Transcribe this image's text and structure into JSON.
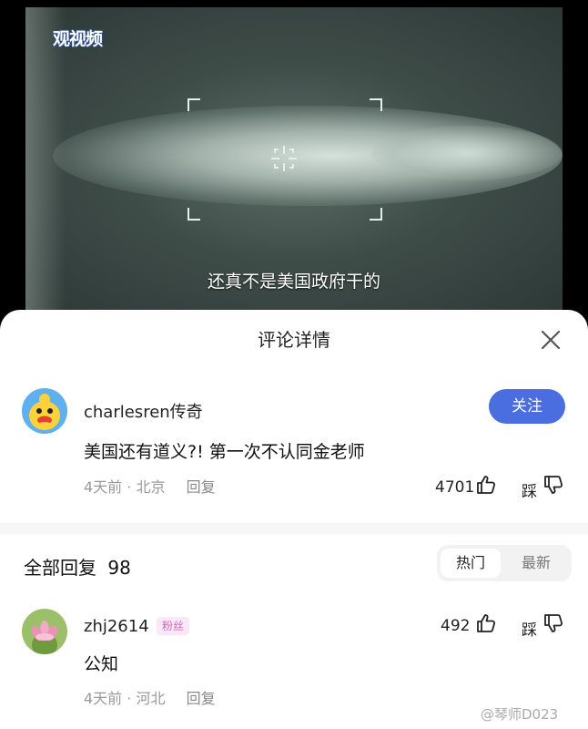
{
  "video": {
    "logo_text": "观视频",
    "subtitle": "还真不是美国政府干的"
  },
  "sheet": {
    "title": "评论详情"
  },
  "main_comment": {
    "username": "charlesren传奇",
    "follow_label": "关注",
    "text": "美国还有道义?! 第一次不认同金老师",
    "time": "4天前",
    "location": "北京",
    "reply_label": "回复",
    "likes": "4701",
    "dislike_label": "踩"
  },
  "replies_section": {
    "title": "全部回复",
    "count": "98",
    "sort_options": [
      "热门",
      "最新"
    ],
    "active_sort": "热门"
  },
  "replies": [
    {
      "username": "zhj2614",
      "badge": "粉丝",
      "text": "公知",
      "time": "4天前",
      "location": "河北",
      "reply_label": "回复",
      "likes": "492",
      "dislike_label": "踩"
    }
  ],
  "watermark": "@琴师D023",
  "colors": {
    "accent": "#4a6ee0",
    "badge_text": "#d06bb8",
    "badge_bg": "#fbe7f5",
    "meta_gray": "#999999"
  }
}
